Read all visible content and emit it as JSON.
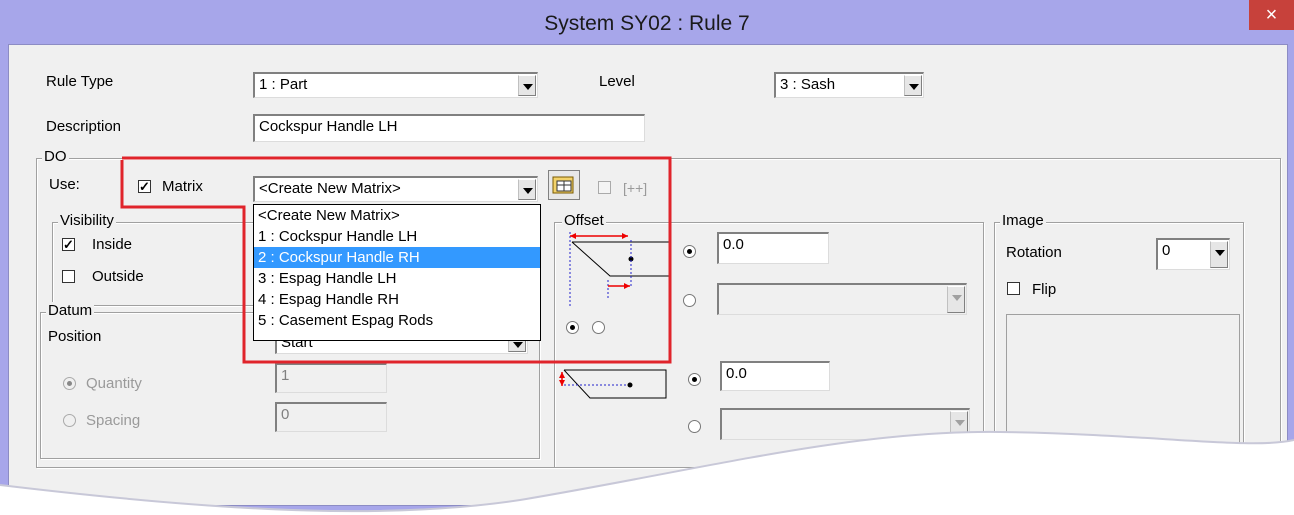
{
  "window": {
    "title": "System SY02 : Rule 7",
    "close_label": "×"
  },
  "form": {
    "rule_type_label": "Rule Type",
    "rule_type_value": "1 : Part",
    "level_label": "Level",
    "level_value": "3 : Sash",
    "description_label": "Description",
    "description_value": "Cockspur Handle LH"
  },
  "do_group": {
    "title": "DO",
    "use_label": "Use:",
    "matrix_label": "Matrix",
    "matrix_checked": true,
    "matrix_value": "<Create New Matrix>",
    "plus_label": "[++]"
  },
  "matrix_dropdown": {
    "items": [
      "<Create New Matrix>",
      "1   : Cockspur Handle LH",
      "2   : Cockspur Handle RH",
      "3   : Espag Handle LH",
      "4   : Espag Handle RH",
      "5   : Casement Espag Rods"
    ],
    "selected_index": 2
  },
  "visibility": {
    "title": "Visibility",
    "inside_label": "Inside",
    "inside_checked": true,
    "outside_label": "Outside",
    "outside_checked": false
  },
  "datum": {
    "title": "Datum",
    "position_label": "Position",
    "position_value": "Start",
    "quantity_label": "Quantity",
    "quantity_value": "1",
    "spacing_label": "Spacing",
    "spacing_value": "0"
  },
  "offset": {
    "title": "Offset",
    "value1": "0.0",
    "value2": "0.0"
  },
  "image": {
    "title": "Image",
    "rotation_label": "Rotation",
    "rotation_value": "0",
    "flip_label": "Flip"
  },
  "colors": {
    "titlebar": "#a7a6ea",
    "highlight_box": "#e0242b",
    "selection": "#3399ff",
    "close": "#c7413b"
  }
}
